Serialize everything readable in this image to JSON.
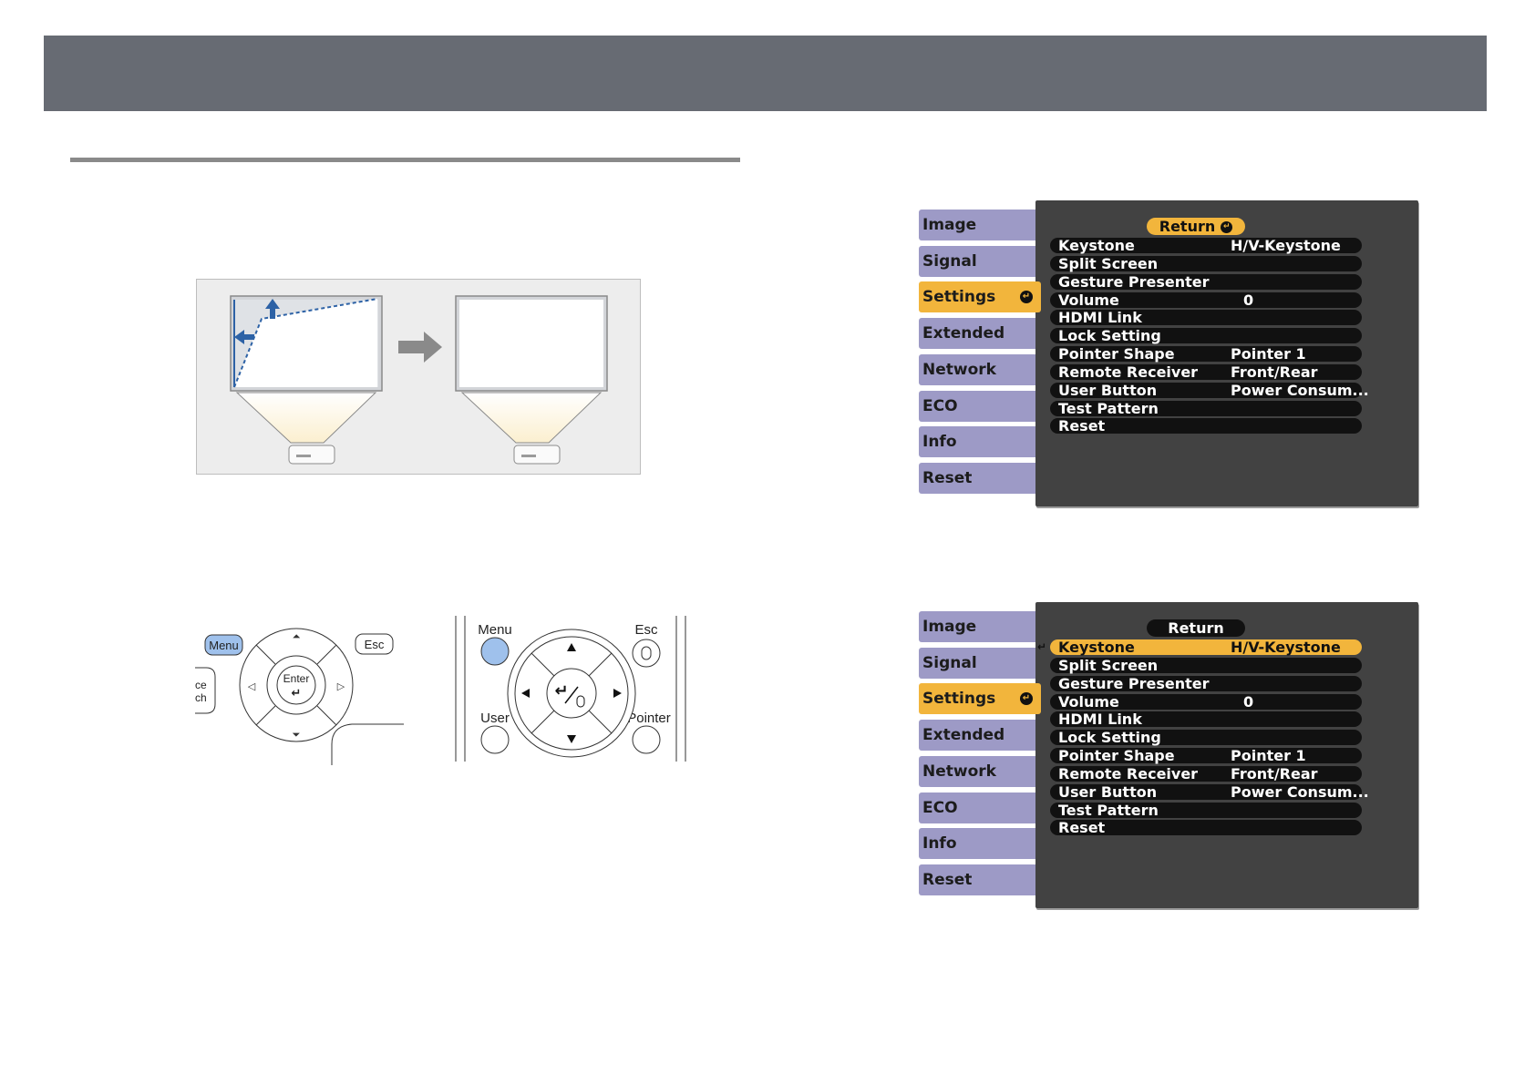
{
  "colors": {
    "header_bar": "#676b73",
    "menu_tab": "#9d9ac6",
    "menu_highlight": "#f2b53c",
    "menu_panel": "#424242"
  },
  "remote_panel": {
    "menu": "Menu",
    "esc": "Esc",
    "enter": "Enter",
    "source_fragment_top": "ce",
    "source_fragment_bottom": "ch"
  },
  "remote": {
    "menu": "Menu",
    "esc": "Esc",
    "user": "User",
    "pointer": "Pointer"
  },
  "menus": [
    {
      "tabs": [
        "Image",
        "Signal",
        "Settings",
        "Extended",
        "Network",
        "ECO",
        "Info",
        "Reset"
      ],
      "active_tab": "Settings",
      "return_label": "Return",
      "return_selected": true,
      "rows": [
        {
          "label": "Keystone",
          "value": "H/V-Keystone"
        },
        {
          "label": "Split Screen",
          "value": ""
        },
        {
          "label": "Gesture Presenter",
          "value": ""
        },
        {
          "label": "Volume",
          "value": "0"
        },
        {
          "label": "HDMI Link",
          "value": ""
        },
        {
          "label": "Lock Setting",
          "value": ""
        },
        {
          "label": "Pointer Shape",
          "value": "Pointer 1"
        },
        {
          "label": "Remote Receiver",
          "value": "Front/Rear"
        },
        {
          "label": "User Button",
          "value": "Power Consum..."
        },
        {
          "label": "Test Pattern",
          "value": ""
        },
        {
          "label": "Reset",
          "value": ""
        }
      ]
    },
    {
      "tabs": [
        "Image",
        "Signal",
        "Settings",
        "Extended",
        "Network",
        "ECO",
        "Info",
        "Reset"
      ],
      "active_tab": "Settings",
      "return_label": "Return",
      "return_selected": false,
      "rows": [
        {
          "label": "Keystone",
          "value": "H/V-Keystone",
          "selected": true
        },
        {
          "label": "Split Screen",
          "value": ""
        },
        {
          "label": "Gesture Presenter",
          "value": ""
        },
        {
          "label": "Volume",
          "value": "0"
        },
        {
          "label": "HDMI Link",
          "value": ""
        },
        {
          "label": "Lock Setting",
          "value": ""
        },
        {
          "label": "Pointer Shape",
          "value": "Pointer 1"
        },
        {
          "label": "Remote Receiver",
          "value": "Front/Rear"
        },
        {
          "label": "User Button",
          "value": "Power Consum..."
        },
        {
          "label": "Test Pattern",
          "value": ""
        },
        {
          "label": "Reset",
          "value": ""
        }
      ]
    }
  ]
}
